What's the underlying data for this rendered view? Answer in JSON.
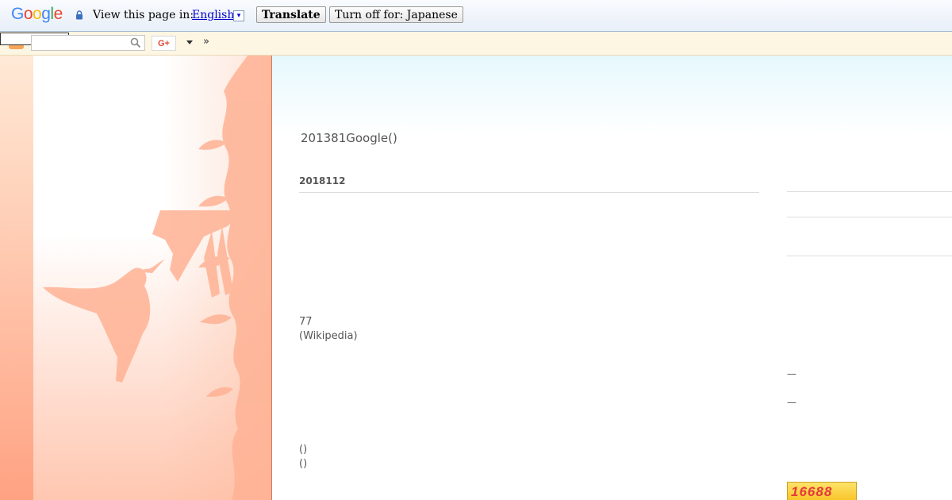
{
  "translate_bar": {
    "logo_letters": [
      "G",
      "o",
      "o",
      "g",
      "l",
      "e"
    ],
    "logo_colors": [
      "#4285f4",
      "#ea4335",
      "#fbbc05",
      "#4285f4",
      "#34a853",
      "#ea4335"
    ],
    "view_label": "View this page in:",
    "language": "English",
    "language_arrow": "▾",
    "translate_button": "Translate",
    "turn_off_button": "Turn off for: Japanese"
  },
  "navbar": {
    "gplus_label": "G+",
    "more_label": "»"
  },
  "header": {
    "blog_title": "201381Google()"
  },
  "post": {
    "date": "2018112",
    "lines_a": [
      "77",
      "(Wikipedia)"
    ],
    "lines_b": [
      "()",
      "()"
    ]
  },
  "sidebar": {
    "dash_1": "—",
    "dash_2": "—",
    "thumbnail_text": "16688"
  },
  "colors": {
    "accent": "#f7a55a",
    "divider": "#d3795a"
  }
}
